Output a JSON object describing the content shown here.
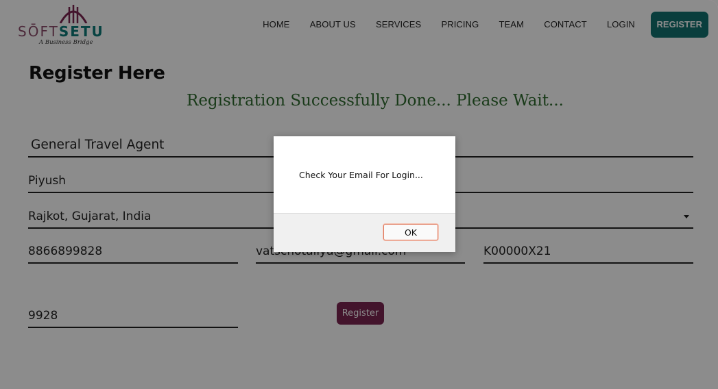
{
  "brand": {
    "name_thin": "SŌFT",
    "name_bold": "SETU",
    "tagline": "A Business Bridge"
  },
  "nav": {
    "items": [
      "HOME",
      "ABOUT US",
      "SERVICES",
      "PRICING",
      "TEAM",
      "CONTACT",
      "LOGIN"
    ],
    "register_label": "REGISTER"
  },
  "page": {
    "title": "Register Here",
    "success_message": "Registration Successfully Done... Please Wait..."
  },
  "form": {
    "agent_type": "General Travel Agent",
    "name": "Piyush",
    "location": "Rajkot, Gujarat, India",
    "phone": "8866899828",
    "email": "vatschotaliya@gmail.com",
    "code": "K00000X21",
    "pin": "9928",
    "submit_label": "Register"
  },
  "dialog": {
    "message": "Check Your Email For Login...",
    "ok_label": "OK"
  },
  "colors": {
    "brand_maroon": "#7a2550",
    "brand_teal": "#11716f",
    "success_green": "#2f6b2f"
  }
}
